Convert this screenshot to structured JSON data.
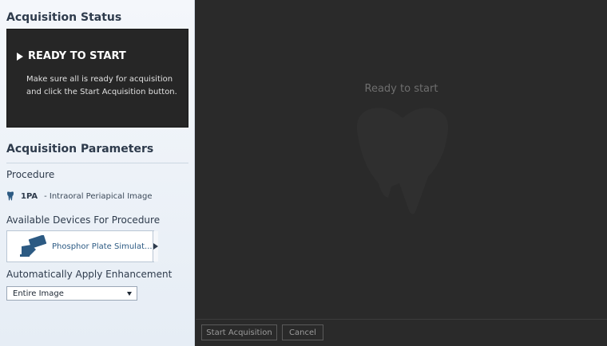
{
  "sidebar": {
    "status_title": "Acquisition Status",
    "status_heading": "READY TO START",
    "status_message": "Make sure all is ready for acquisition and click the Start Acquisition button.",
    "params_title": "Acquisition Parameters",
    "procedure_label": "Procedure",
    "procedure_code": "1PA",
    "procedure_desc": "- Intraoral Periapical Image",
    "devices_label": "Available Devices For Procedure",
    "device_name": "Phosphor Plate Simulat...",
    "enhancement_label": "Automatically Apply Enhancement",
    "enhancement_value": "Entire Image"
  },
  "viewer": {
    "message": "Ready to start"
  },
  "footer": {
    "start_label": "Start Acquisition",
    "cancel_label": "Cancel"
  },
  "colors": {
    "viewer_bg": "#2a2a2a",
    "sidebar_bg": "#eef2f7",
    "accent_text": "#2c5a83"
  },
  "icons": [
    "play-icon",
    "tooth-icon",
    "phosphor-plate-device-icon",
    "chevron-right-icon",
    "chevron-down-icon"
  ]
}
